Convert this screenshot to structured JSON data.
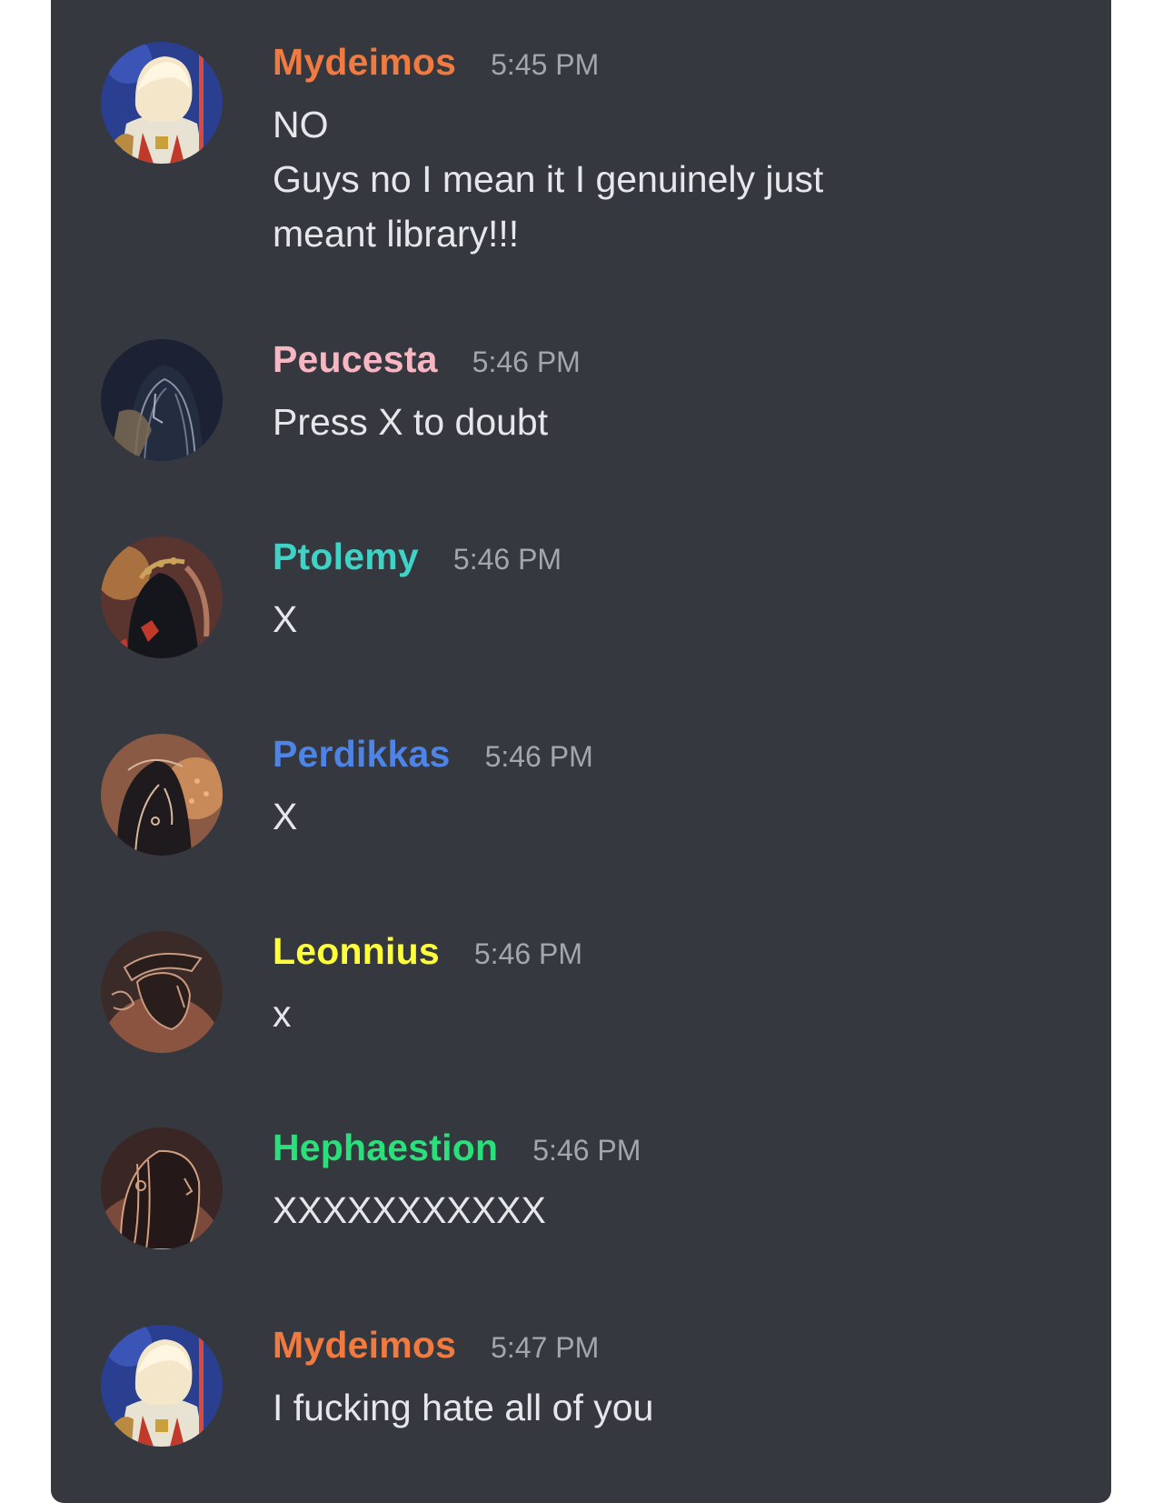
{
  "messages": [
    {
      "username": "Mydeimos",
      "color": "#f07a3f",
      "time": "5:45 PM",
      "avatar_icon": "avatar-blond-warrior-icon",
      "lines": [
        "NO",
        "Guys no I mean it I genuinely just",
        "meant library!!!"
      ]
    },
    {
      "username": "Peucesta",
      "color": "#f8b6c3",
      "time": "5:46 PM",
      "avatar_icon": "avatar-dark-longhair-icon",
      "lines": [
        "Press X to doubt"
      ]
    },
    {
      "username": "Ptolemy",
      "color": "#3fd2c6",
      "time": "5:46 PM",
      "avatar_icon": "avatar-laurel-wreath-icon",
      "lines": [
        "X"
      ]
    },
    {
      "username": "Perdikkas",
      "color": "#4e84e6",
      "time": "5:46 PM",
      "avatar_icon": "avatar-sketch-profile-icon",
      "lines": [
        "X"
      ]
    },
    {
      "username": "Leonnius",
      "color": "#ffff3a",
      "time": "5:46 PM",
      "avatar_icon": "avatar-hat-profile-icon",
      "lines": [
        "x"
      ]
    },
    {
      "username": "Hephaestion",
      "color": "#2ae07a",
      "time": "5:46 PM",
      "avatar_icon": "avatar-braided-profile-icon",
      "lines": [
        "XXXXXXXXXXX"
      ]
    },
    {
      "username": "Mydeimos",
      "color": "#f07a3f",
      "time": "5:47 PM",
      "avatar_icon": "avatar-blond-warrior-icon",
      "lines": [
        "I fucking hate all of you"
      ]
    }
  ]
}
